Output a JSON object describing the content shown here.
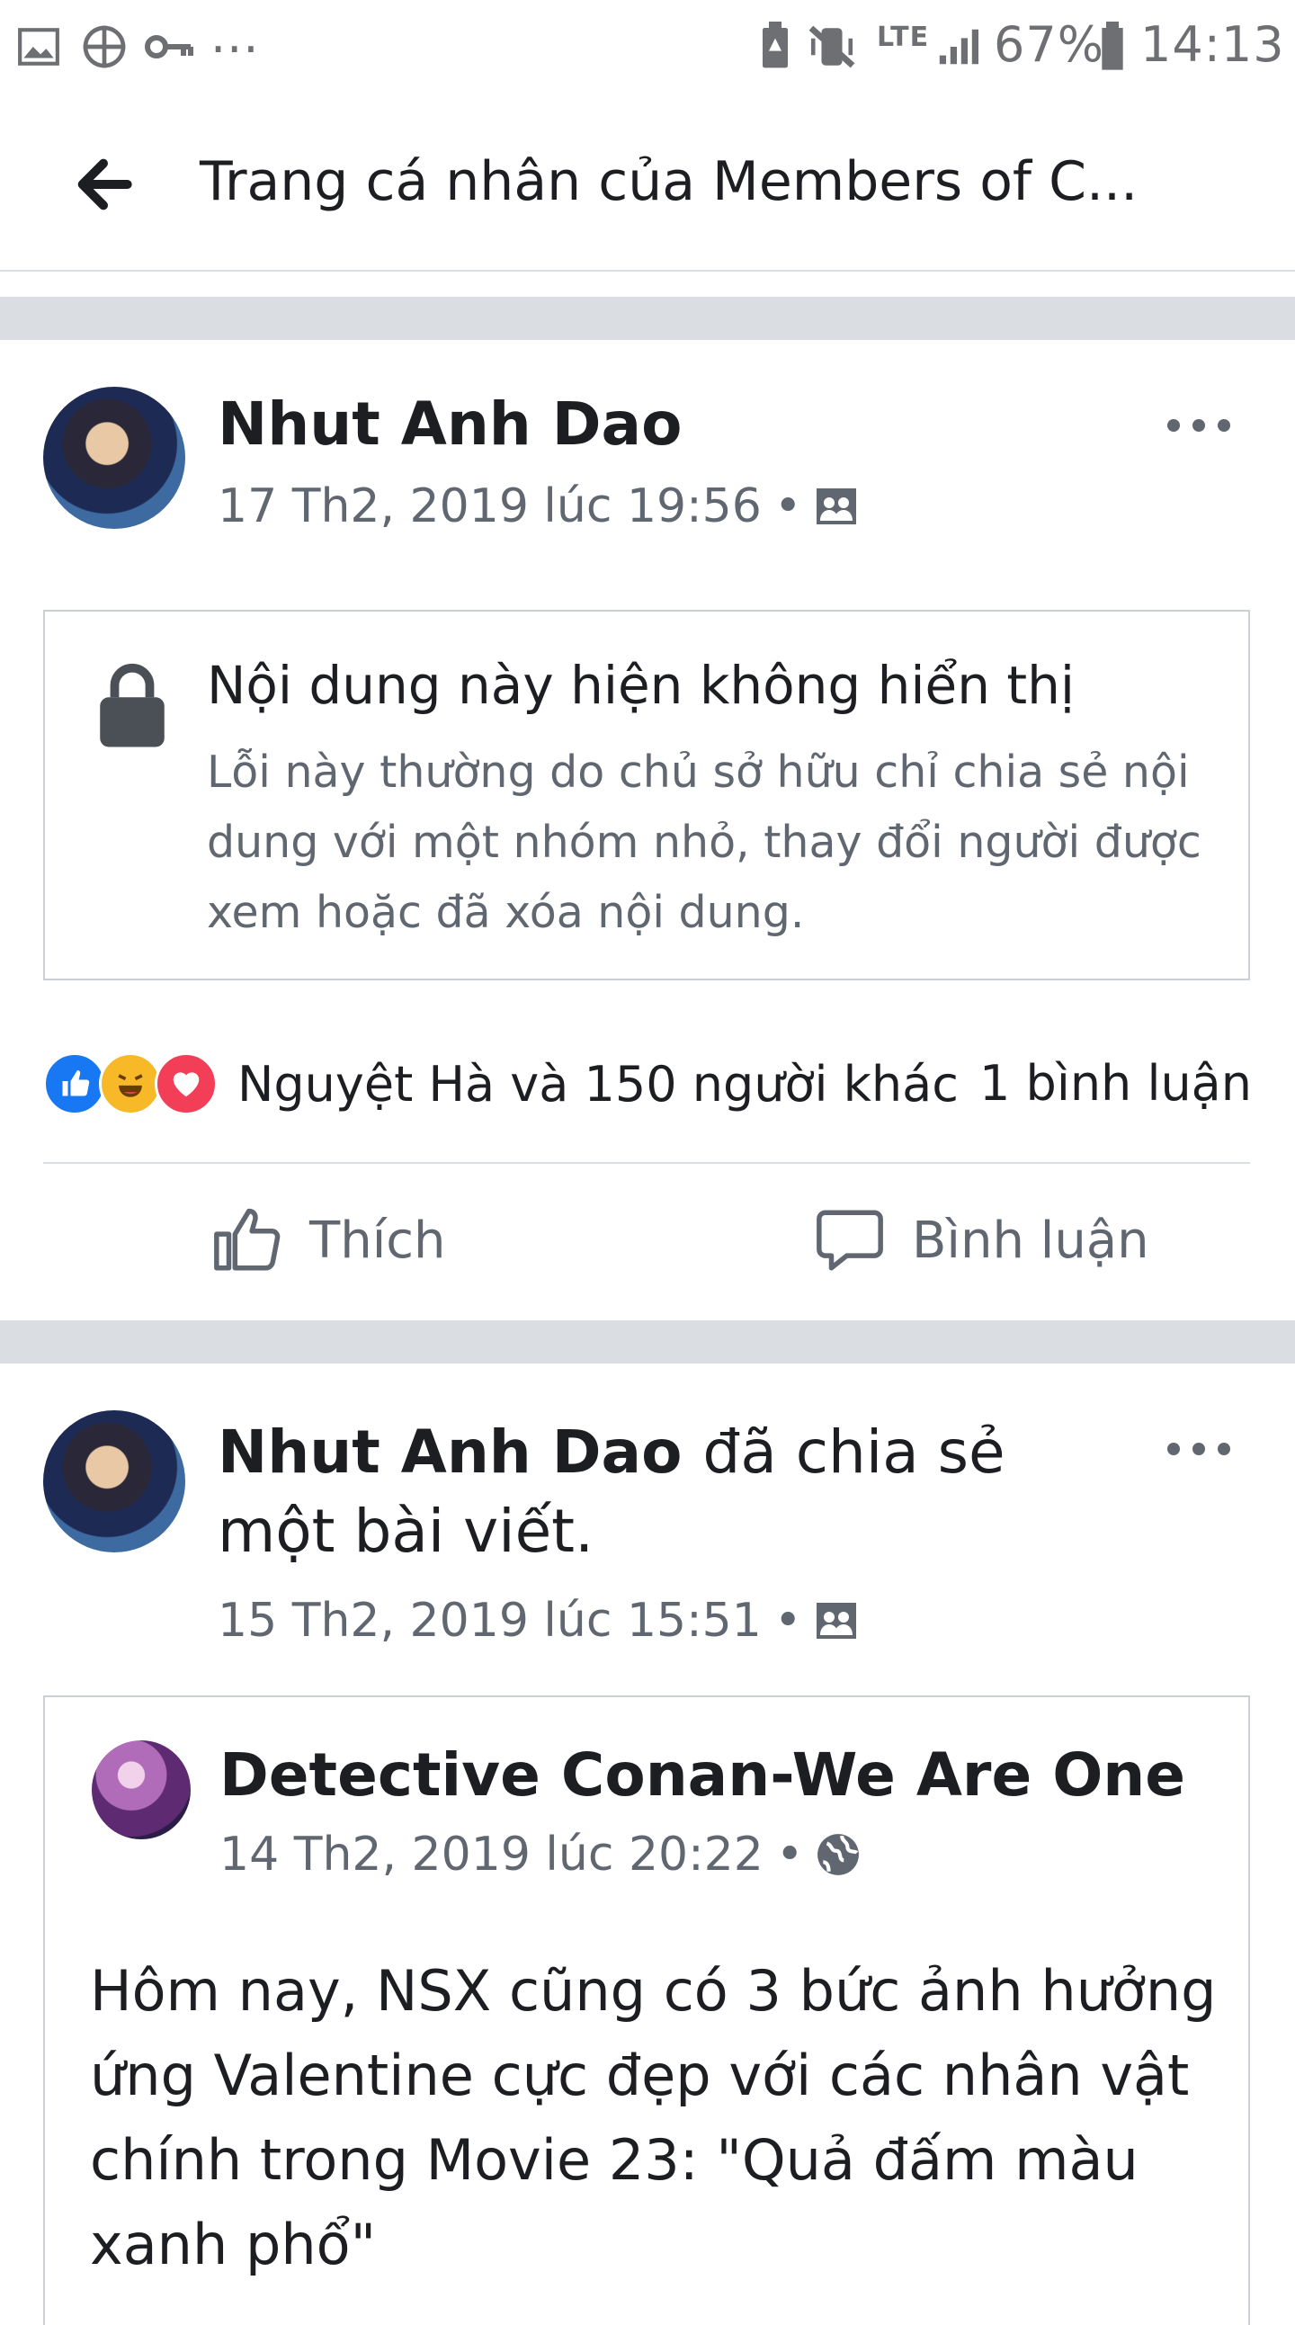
{
  "status_bar": {
    "battery_percent": "67%",
    "time": "14:13",
    "network": "LTE",
    "more": "..."
  },
  "header": {
    "title": "Trang cá nhân của Members of C..."
  },
  "post1": {
    "author": "Nhut Anh Dao",
    "timestamp": "17 Th2, 2019 lúc 19:56",
    "unavailable": {
      "title": "Nội dung này hiện không hiển thị",
      "description": "Lỗi này thường do chủ sở hữu chỉ chia sẻ nội dung với một nhóm nhỏ, thay đổi người được xem hoặc đã xóa nội dung."
    },
    "reactions_text": "Nguyệt Hà và 150 người khác",
    "comments_text": "1 bình luận",
    "actions": {
      "like": "Thích",
      "comment": "Bình luận"
    }
  },
  "post2": {
    "author": "Nhut Anh Dao",
    "shared_suffix": "đã chia sẻ một bài viết.",
    "timestamp": "15 Th2, 2019 lúc 15:51",
    "shared": {
      "page_name": "Detective Conan-We Are One",
      "timestamp": "14 Th2, 2019 lúc 20:22",
      "text": "Hôm nay, NSX cũng có 3 bức ảnh hưởng ứng Valentine cực đẹp với các nhân vật chính trong Movie 23: \"Quả đấm màu xanh phổ\""
    }
  },
  "colors": {
    "separator": "#dadde1",
    "text": "#1c1e21",
    "secondary": "#606770",
    "like_blue": "#1877f2",
    "haha_yellow": "#f7b928",
    "love_red": "#f33e58"
  }
}
